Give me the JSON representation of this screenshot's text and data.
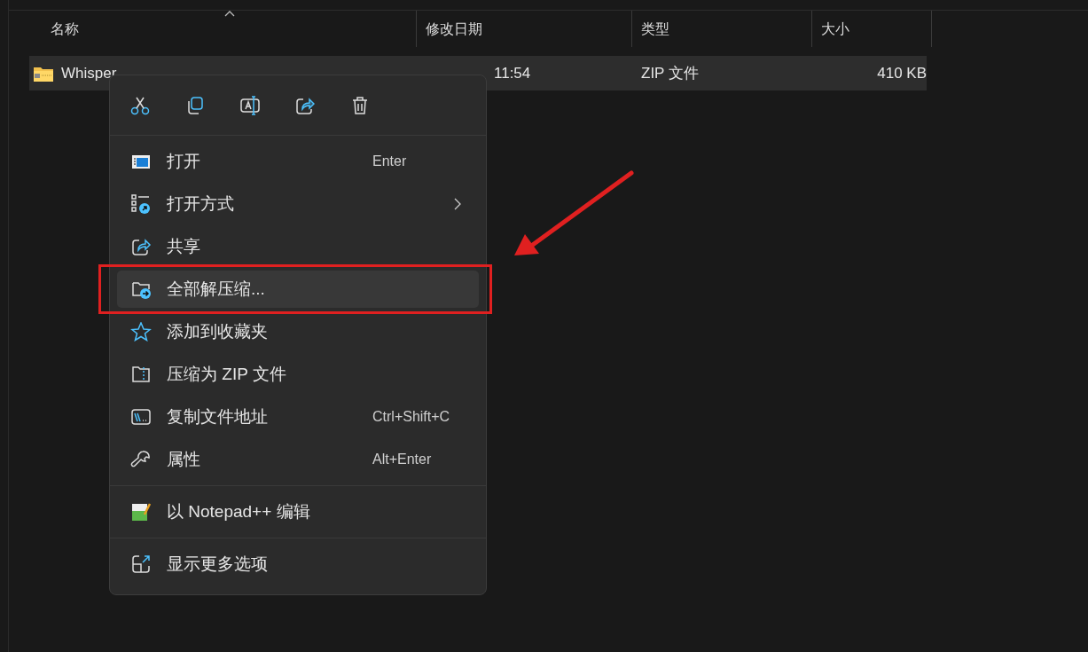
{
  "columns": [
    {
      "label": "名称",
      "sorted": true
    },
    {
      "label": "修改日期",
      "sorted": false
    },
    {
      "label": "类型",
      "sorted": false
    },
    {
      "label": "大小",
      "sorted": false
    }
  ],
  "files": [
    {
      "name": "Whisper",
      "date": "11:54",
      "type": "ZIP 文件",
      "size": "410 KB",
      "selected": true
    }
  ],
  "context_menu": {
    "groups": [
      [
        {
          "label": "打开",
          "shortcut": "Enter",
          "submenu": false,
          "highlighted": false,
          "marked": false
        },
        {
          "label": "打开方式",
          "submenu": true,
          "highlighted": false,
          "marked": false
        },
        {
          "label": "共享",
          "submenu": false,
          "highlighted": false,
          "marked": false
        },
        {
          "label": "全部解压缩...",
          "submenu": false,
          "highlighted": true,
          "marked": true
        },
        {
          "label": "添加到收藏夹",
          "submenu": false,
          "highlighted": false,
          "marked": false
        },
        {
          "label": "压缩为 ZIP 文件",
          "submenu": false,
          "highlighted": false,
          "marked": false
        },
        {
          "label": "复制文件地址",
          "shortcut": "Ctrl+Shift+C",
          "submenu": false,
          "highlighted": false,
          "marked": false
        },
        {
          "label": "属性",
          "shortcut": "Alt+Enter",
          "submenu": false,
          "highlighted": false,
          "marked": false
        }
      ],
      [
        {
          "label": "以 Notepad++ 编辑",
          "submenu": false,
          "highlighted": false,
          "marked": false
        }
      ],
      [
        {
          "label": "显示更多选项",
          "submenu": false,
          "highlighted": false,
          "marked": false
        }
      ]
    ]
  }
}
